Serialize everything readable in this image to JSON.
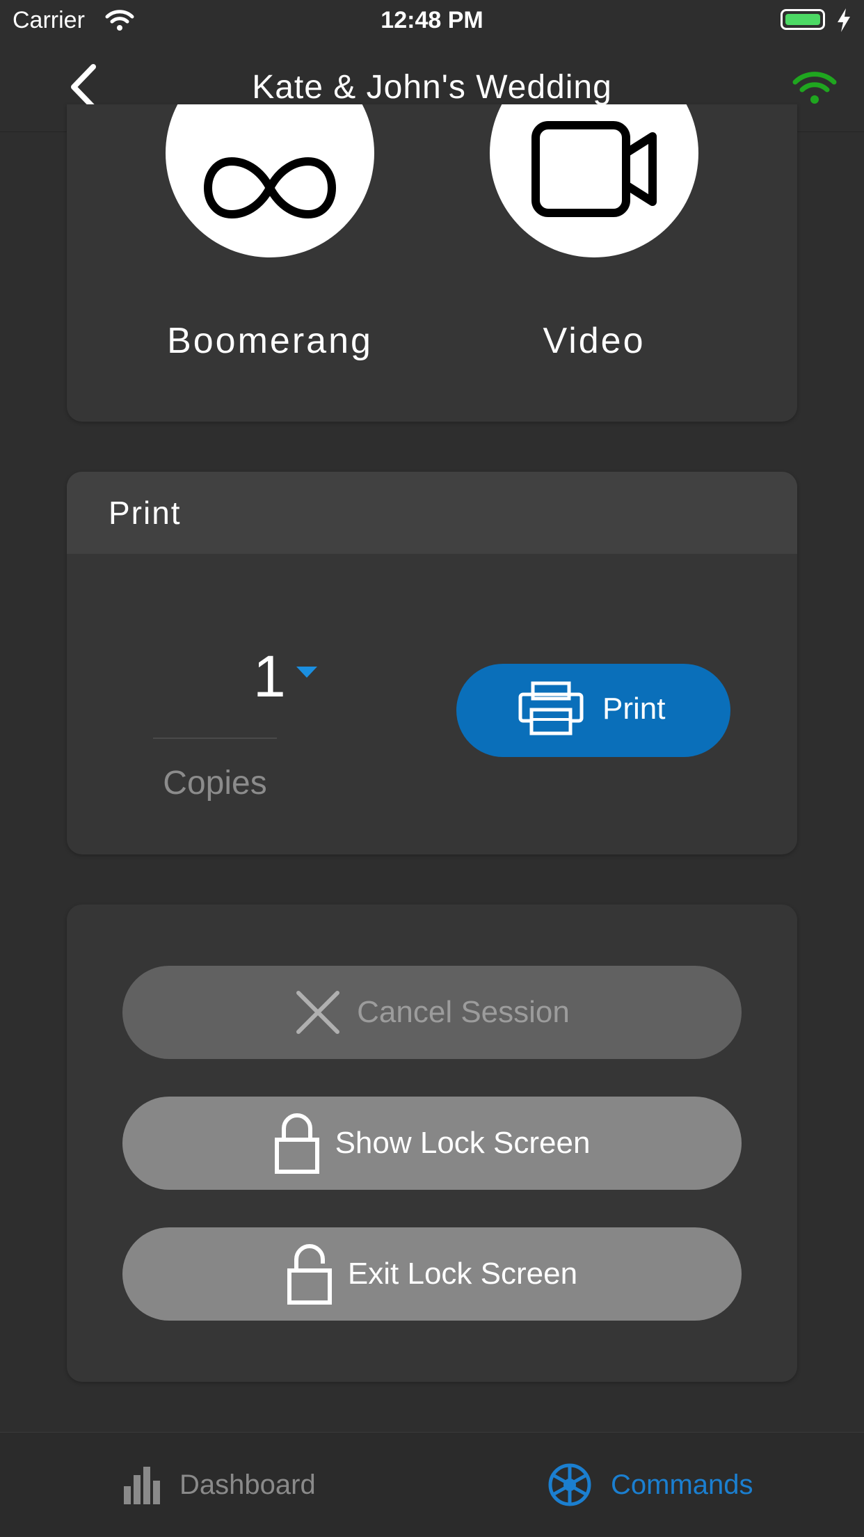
{
  "status_bar": {
    "carrier": "Carrier",
    "time": "12:48 PM"
  },
  "nav": {
    "title": "Kate & John's Wedding",
    "back_icon": "chevron-left-icon",
    "connection_icon": "wifi-icon"
  },
  "modes": [
    {
      "label": "Boomerang",
      "icon": "infinity-icon"
    },
    {
      "label": "Video",
      "icon": "video-camera-icon"
    }
  ],
  "print_card": {
    "title": "Print",
    "copies_value": "1",
    "copies_label": "Copies",
    "print_button_label": "Print"
  },
  "session_card": {
    "cancel_label": "Cancel Session",
    "show_lock_label": "Show Lock Screen",
    "exit_lock_label": "Exit Lock Screen"
  },
  "tab_bar": {
    "tabs": [
      {
        "label": "Dashboard",
        "icon": "bar-chart-icon",
        "active": false
      },
      {
        "label": "Commands",
        "icon": "aperture-icon",
        "active": true
      }
    ]
  },
  "colors": {
    "background": "#2e2e2e",
    "card": "#363636",
    "accent_blue": "#0a6fba",
    "active_tab": "#1b7fd0",
    "inactive_tab": "#8a8a8a",
    "connection_green": "#1fa61f",
    "battery_green": "#4cd964"
  }
}
